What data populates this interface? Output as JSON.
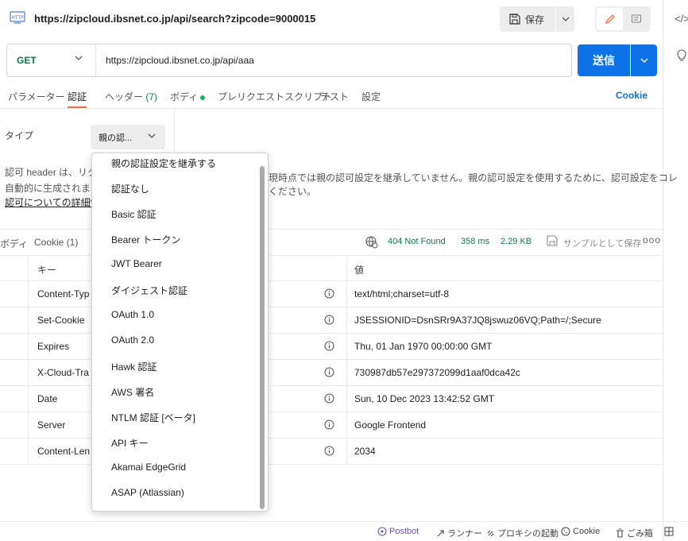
{
  "title": {
    "url": "https://zipcloud.ibsnet.co.jp/api/search?zipcode=9000015",
    "save_label": "保存",
    "http_badge": "HTTP"
  },
  "request": {
    "method": "GET",
    "url": "https://zipcloud.ibsnet.co.jp/api/aaa",
    "send_label": "送信"
  },
  "tabs": [
    {
      "label": "パラメーター"
    },
    {
      "label": "認証",
      "active": true
    },
    {
      "label": "ヘッダー",
      "count": "(7)"
    },
    {
      "label": "ボディ",
      "indicator_color": "#0cbb52"
    },
    {
      "label": "プレリクエストスクリプト"
    },
    {
      "label": "テスト"
    },
    {
      "label": "設定"
    }
  ],
  "cookie_link": "Cookie",
  "auth": {
    "type_label": "タイプ",
    "type_selected": "親の認...",
    "desc_line1": "認可 header は、リクエ",
    "desc_line2": "自動的に生成されます。",
    "desc_link": "認可についての詳細情報",
    "desc_right1": "現時点では親の認可設定を継承していません。親の認可設定を使用するために、認可設定をコレ",
    "desc_right2": "ください。"
  },
  "dropdown": {
    "items": [
      "親の認証設定を継承する",
      "認証なし",
      "Basic 認証",
      "Bearer トークン",
      "JWT Bearer",
      "ダイジェスト認証",
      "OAuth 1.0",
      "OAuth 2.0",
      "Hawk 認証",
      "AWS 署名",
      "NTLM 認証 [ベータ]",
      "API キー",
      "Akamai EdgeGrid",
      "ASAP (Atlassian)"
    ]
  },
  "response": {
    "tabs": [
      "ボディ",
      "Cookie (1)"
    ],
    "status": "404 Not Found",
    "time": "358 ms",
    "size": "2.29 KB",
    "save_example": "サンプルとして保存",
    "more": "ooo"
  },
  "headers_table": {
    "columns": [
      "キー",
      "値"
    ],
    "rows": [
      {
        "key": "Content-Typ",
        "value": "text/html;charset=utf-8"
      },
      {
        "key": "Set-Cookie",
        "value": "JSESSIONID=DsnSRr9A37JQ8jswuz06VQ;Path=/;Secure"
      },
      {
        "key": "Expires",
        "value": "Thu, 01 Jan 1970 00:00:00 GMT"
      },
      {
        "key": "X-Cloud-Tra",
        "value": "730987db57e297372099d1aaf0dca42c"
      },
      {
        "key": "Date",
        "value": "Sun, 10 Dec 2023 13:42:52 GMT"
      },
      {
        "key": "Server",
        "value": "Google Frontend"
      },
      {
        "key": "Content-Len",
        "value": "2034"
      }
    ]
  },
  "footer": {
    "postbot": "Postbot",
    "runner": "ランナー",
    "proxy": "プロキシの起動",
    "cookies": "Cookie",
    "trash": "ごみ箱"
  },
  "colors": {
    "accent_orange": "#ff6c37",
    "send_blue": "#0c72e8",
    "status_green": "#0b7a4b",
    "postbot_purple": "#6c4ec4"
  }
}
